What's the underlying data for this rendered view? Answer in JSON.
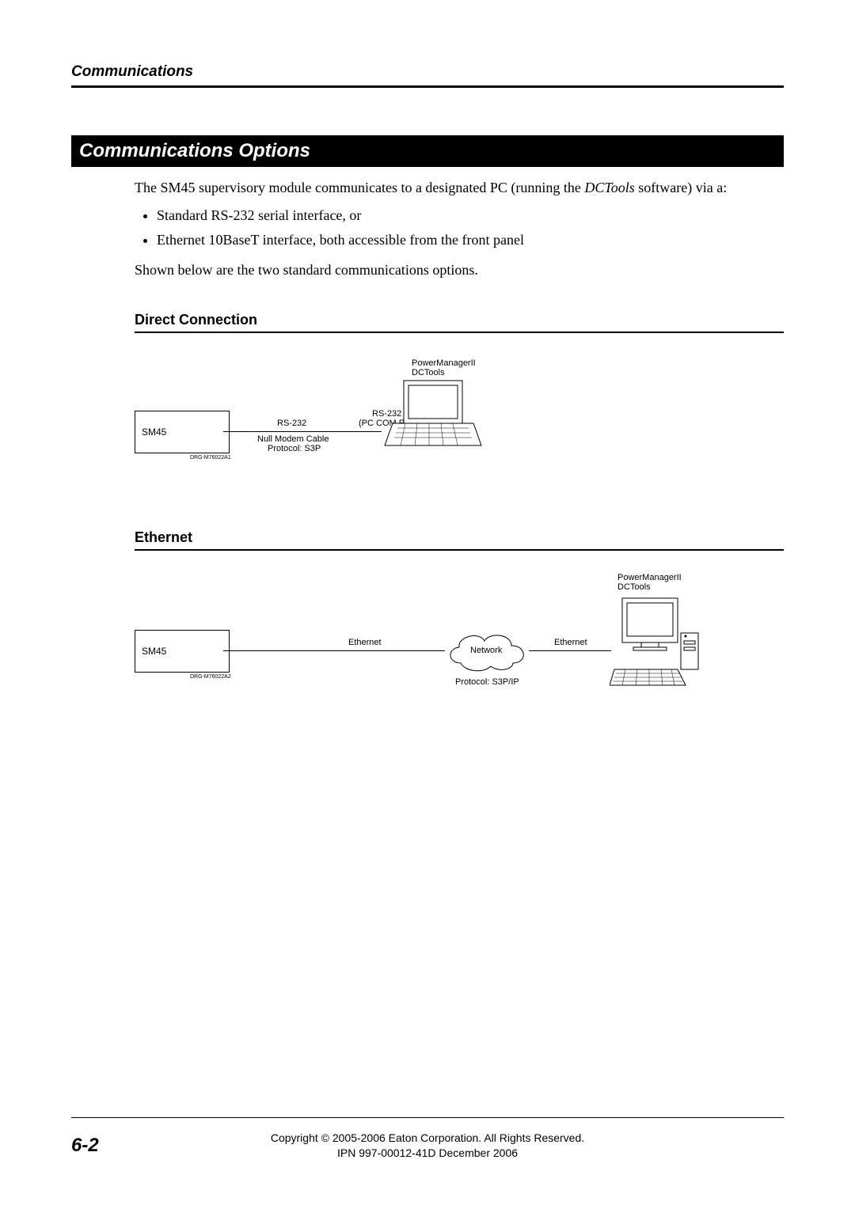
{
  "header": {
    "chapter": "Communications"
  },
  "section": {
    "title": "Communications Options"
  },
  "intro": {
    "p1_a": "The SM45 supervisory module communicates to a designated PC (running the ",
    "p1_em": "DCTools",
    "p1_b": " software) via a:",
    "bullets": [
      "Standard RS-232 serial interface, or",
      "Ethernet 10BaseT interface, both accessible from the front panel"
    ],
    "p2": "Shown below are the two standard communications options."
  },
  "direct": {
    "heading": "Direct Connection",
    "sm45": "SM45",
    "rs232_top": "RS-232",
    "cable": "Null Modem Cable",
    "protocol": "Protocol: S3P",
    "port_top": "RS-232",
    "port_bottom": "(PC COM Port)",
    "pc_line1": "PowerManagerII",
    "pc_line2": "DCTools",
    "ref": "DRG-M76022A1"
  },
  "ethernet": {
    "heading": "Ethernet",
    "sm45": "SM45",
    "eth1": "Ethernet",
    "network": "Network",
    "eth2": "Ethernet",
    "protocol": "Protocol: S3P/IP",
    "pc_line1": "PowerManagerII",
    "pc_line2": "DCTools",
    "ref": "DRG-M76022A2"
  },
  "footer": {
    "page": "6-2",
    "copyright": "Copyright © 2005-2006 Eaton Corporation.  All Rights Reserved.",
    "ipn": "IPN 997-00012-41D    December 2006"
  }
}
